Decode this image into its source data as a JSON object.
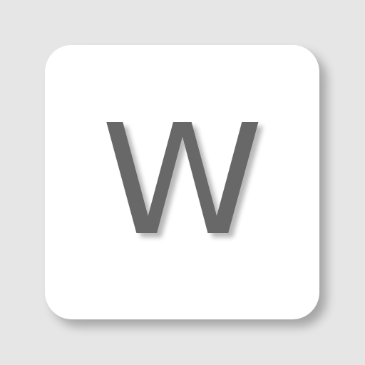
{
  "key": {
    "label": "W",
    "colors": {
      "background": "#e6e6e6",
      "key_face": "#ffffff",
      "letter": "#686868"
    }
  }
}
